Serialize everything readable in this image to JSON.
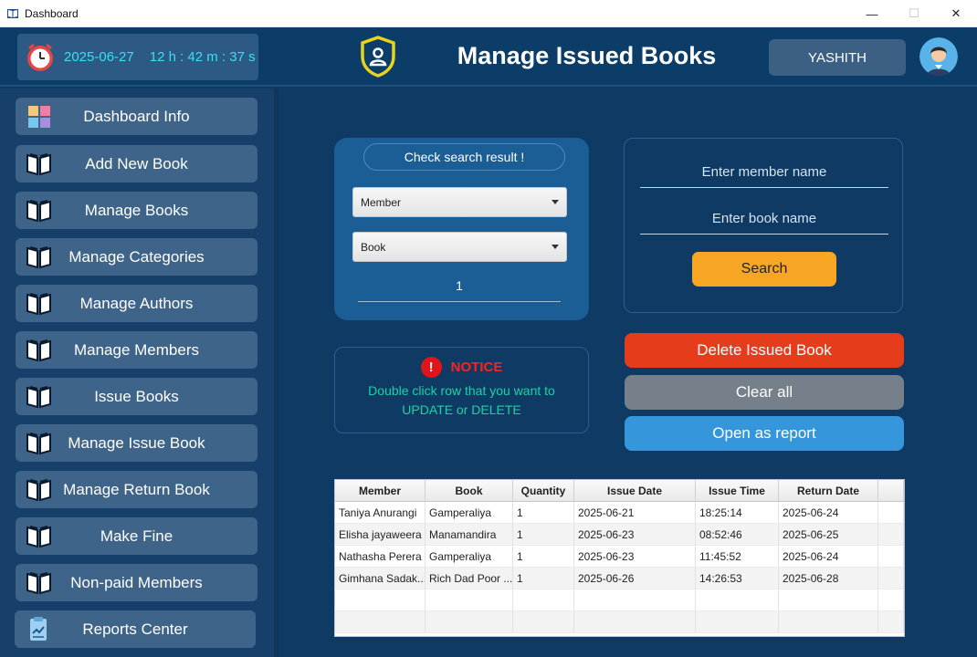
{
  "window": {
    "title": "Dashboard"
  },
  "header": {
    "date": "2025-06-27",
    "time": "12 h : 42 m : 37 s",
    "page_title": "Manage Issued Books",
    "user": "YASHITH"
  },
  "sidebar": {
    "items": [
      {
        "label": "Dashboard Info",
        "icon": "dashboard-tiles-icon"
      },
      {
        "label": "Add New Book",
        "icon": "book-icon"
      },
      {
        "label": "Manage Books",
        "icon": "book-icon"
      },
      {
        "label": "Manage Categories",
        "icon": "book-icon"
      },
      {
        "label": "Manage Authors",
        "icon": "book-icon"
      },
      {
        "label": "Manage Members",
        "icon": "book-icon"
      },
      {
        "label": "Issue Books",
        "icon": "book-icon"
      },
      {
        "label": "Manage Issue Book",
        "icon": "book-icon"
      },
      {
        "label": "Manage Return Book",
        "icon": "book-icon"
      },
      {
        "label": "Make Fine",
        "icon": "book-icon"
      },
      {
        "label": "Non-paid Members",
        "icon": "book-icon"
      },
      {
        "label": "Reports Center",
        "icon": "report-clipboard-icon"
      }
    ]
  },
  "search_panel": {
    "header": "Check search result !",
    "member_select": "Member",
    "book_select": "Book",
    "quantity": "1"
  },
  "filter_panel": {
    "member_placeholder": "Enter member name",
    "book_placeholder": "Enter book name",
    "search_label": "Search"
  },
  "notice": {
    "title": "NOTICE",
    "line1": "Double click row that you want to",
    "line2": "UPDATE  or DELETE"
  },
  "actions": {
    "delete_label": "Delete Issued Book",
    "clear_label": "Clear all",
    "report_label": "Open as report"
  },
  "table": {
    "columns": [
      "Member",
      "Book",
      "Quantity",
      "Issue Date",
      "Issue Time",
      "Return Date"
    ],
    "rows": [
      [
        "Taniya Anurangi",
        "Gamperaliya",
        "1",
        "2025-06-21",
        "18:25:14",
        "2025-06-24"
      ],
      [
        "Elisha jayaweera",
        "Manamandira",
        "1",
        "2025-06-23",
        "08:52:46",
        "2025-06-25"
      ],
      [
        "Nathasha Perera",
        "Gamperaliya",
        "1",
        "2025-06-23",
        "11:45:52",
        "2025-06-24"
      ],
      [
        "Gimhana Sadak...",
        "Rich Dad Poor ...",
        "1",
        "2025-06-26",
        "14:26:53",
        "2025-06-28"
      ]
    ]
  },
  "colors": {
    "background": "#0e3a64",
    "accent_cyan": "#35e0ef",
    "search_button": "#f6a623",
    "delete_button": "#e53d1c",
    "clear_button": "#76808b",
    "report_button": "#3596dc",
    "notice_red": "#ff2020",
    "notice_text": "#18d4a4"
  }
}
